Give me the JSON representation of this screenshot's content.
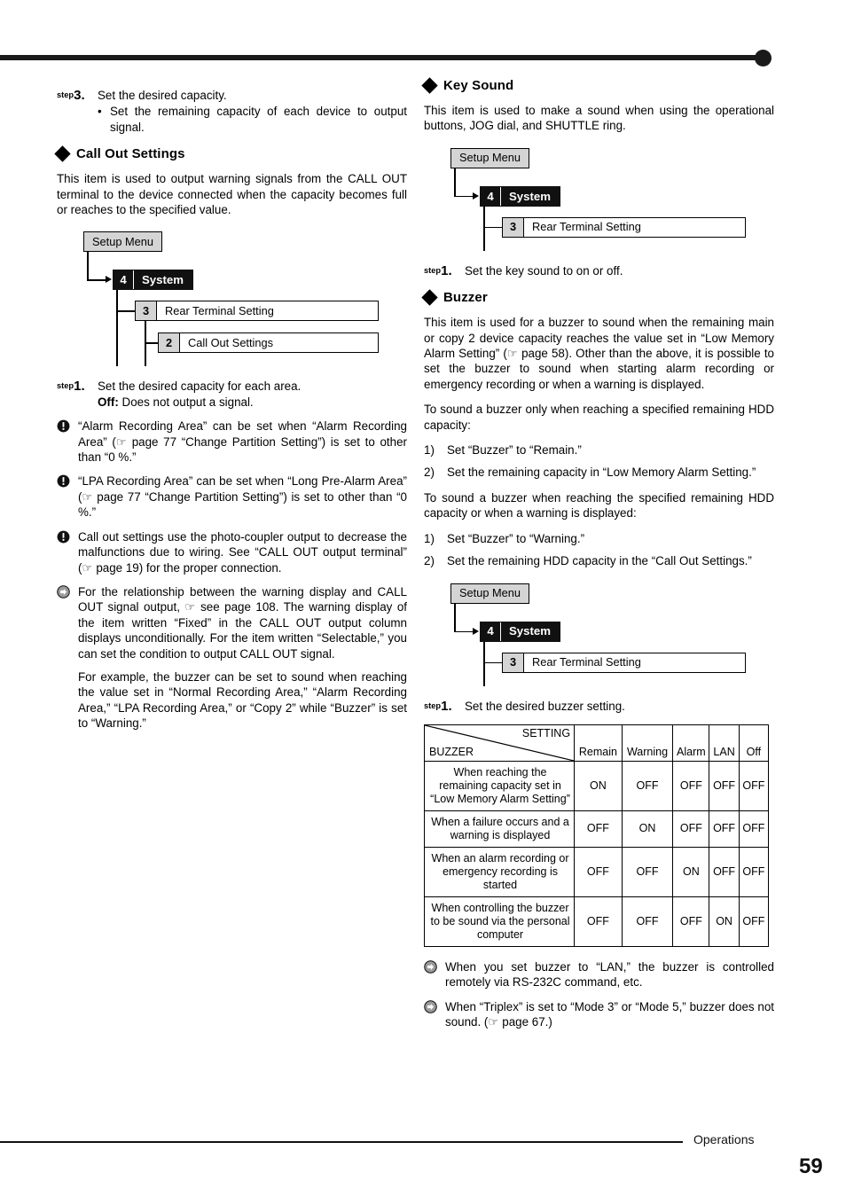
{
  "footer": {
    "section_label": "Operations",
    "page_number": "59"
  },
  "icons": {
    "diamond": "diamond-bullet-icon",
    "caution": "exclamation-circle-icon",
    "info": "arrow-circle-icon",
    "hand": "☞"
  },
  "left_column": {
    "step3": {
      "step_word": "step",
      "number": "3.",
      "text": "Set the desired capacity.",
      "bullet": "•",
      "sub_text": "Set the remaining capacity of each device to output signal."
    },
    "call_out_heading": "Call Out Settings",
    "call_out_intro": "This item is used to output warning signals from the CALL OUT terminal to the device connected when the capacity becomes full or reaches to the specified value.",
    "diagram": {
      "setup_menu": "Setup Menu",
      "system_num": "4",
      "system_label": "System",
      "item1_num": "3",
      "item1_label": "Rear Terminal Setting",
      "item2_num": "2",
      "item2_label": "Call Out Settings"
    },
    "step1": {
      "step_word": "step",
      "number": "1.",
      "text": "Set the desired capacity for each area.",
      "off_label": "Off:",
      "off_text": " Does not output a signal."
    },
    "notes": [
      {
        "type": "caution",
        "text_parts": [
          "“Alarm Recording Area” can be set when “Alarm Recording Area” (",
          ") is set to other than “0 %.”"
        ],
        "ref": " page 77 “Change Partition Setting”"
      },
      {
        "type": "caution",
        "text_parts": [
          "“LPA Recording Area” can be set when “Long Pre-Alarm Area” (",
          ") is set to other than “0 %.”"
        ],
        "ref": " page 77 “Change Partition Setting”"
      },
      {
        "type": "caution",
        "text_parts": [
          "Call out settings use the photo-coupler output to decrease the malfunctions due to wiring. See “CALL OUT output terminal” (",
          ") for the proper connection."
        ],
        "ref": " page 19"
      },
      {
        "type": "info",
        "text_parts": [
          "For the relationship between the warning display and CALL OUT signal output, ",
          " see page 108. The warning display of the item written “Fixed” in the CALL OUT output column displays unconditionally. For the item written “Selectable,” you can set the condition to output CALL OUT signal."
        ],
        "ref": "",
        "paragraph2": "For example, the buzzer can be set to sound when reaching the value set in “Normal Recording Area,” “Alarm Recording Area,” “LPA Recording Area,” or “Copy 2” while “Buzzer” is set to “Warning.”"
      }
    ]
  },
  "right_column": {
    "key_sound_heading": "Key Sound",
    "key_sound_intro": "This item is used to make a sound when using the operational buttons, JOG dial, and SHUTTLE ring.",
    "diagram1": {
      "setup_menu": "Setup Menu",
      "system_num": "4",
      "system_label": "System",
      "item1_num": "3",
      "item1_label": "Rear Terminal Setting"
    },
    "key_sound_step": {
      "step_word": "step",
      "number": "1.",
      "text": "Set the key sound to on or off."
    },
    "buzzer_heading": "Buzzer",
    "buzzer_intro_parts": [
      "This item is used for a buzzer to sound when the remaining main or copy 2 device capacity reaches the value set in “Low Memory Alarm Setting” (",
      " page 58). Other than the above, it is possible to set the buzzer to sound when starting alarm recording or emergency recording or when a warning is displayed."
    ],
    "list1_intro": "To sound a buzzer only when reaching a specified remaining HDD capacity:",
    "list1": [
      {
        "n": "1)",
        "t": "Set “Buzzer” to “Remain.”"
      },
      {
        "n": "2)",
        "t": "Set the remaining capacity in “Low Memory Alarm Setting.”"
      }
    ],
    "list2_intro": "To sound a buzzer when reaching the specified remaining HDD capacity or when a warning is displayed:",
    "list2": [
      {
        "n": "1)",
        "t": "Set “Buzzer” to “Warning.”"
      },
      {
        "n": "2)",
        "t": "Set the remaining HDD capacity in the “Call Out Settings.”"
      }
    ],
    "diagram2": {
      "setup_menu": "Setup Menu",
      "system_num": "4",
      "system_label": "System",
      "item1_num": "3",
      "item1_label": "Rear Terminal Setting"
    },
    "buzzer_step": {
      "step_word": "step",
      "number": "1.",
      "text": "Set the desired buzzer setting."
    },
    "table": {
      "corner_top_right": "SETTING",
      "corner_bottom_left": "BUZZER",
      "columns": [
        "Remain",
        "Warning",
        "Alarm",
        "LAN",
        "Off"
      ],
      "rows": [
        {
          "label": "When reaching the remaining capacity set in “Low Memory Alarm Setting”",
          "values": [
            "ON",
            "OFF",
            "OFF",
            "OFF",
            "OFF"
          ]
        },
        {
          "label": "When a failure occurs and a warning is displayed",
          "values": [
            "OFF",
            "ON",
            "OFF",
            "OFF",
            "OFF"
          ]
        },
        {
          "label": "When an alarm recording or emergency recording is started",
          "values": [
            "OFF",
            "OFF",
            "ON",
            "OFF",
            "OFF"
          ]
        },
        {
          "label": "When controlling the buzzer to be sound via the personal computer",
          "values": [
            "OFF",
            "OFF",
            "OFF",
            "ON",
            "OFF"
          ]
        }
      ]
    },
    "notes": [
      {
        "type": "info",
        "text": "When you set buzzer to “LAN,” the buzzer is controlled remotely via RS-232C command, etc."
      },
      {
        "type": "info",
        "text_parts": [
          "When “Triplex” is set to “Mode 3” or “Mode 5,” buzzer does not sound. (",
          " page 67.)"
        ]
      }
    ]
  }
}
